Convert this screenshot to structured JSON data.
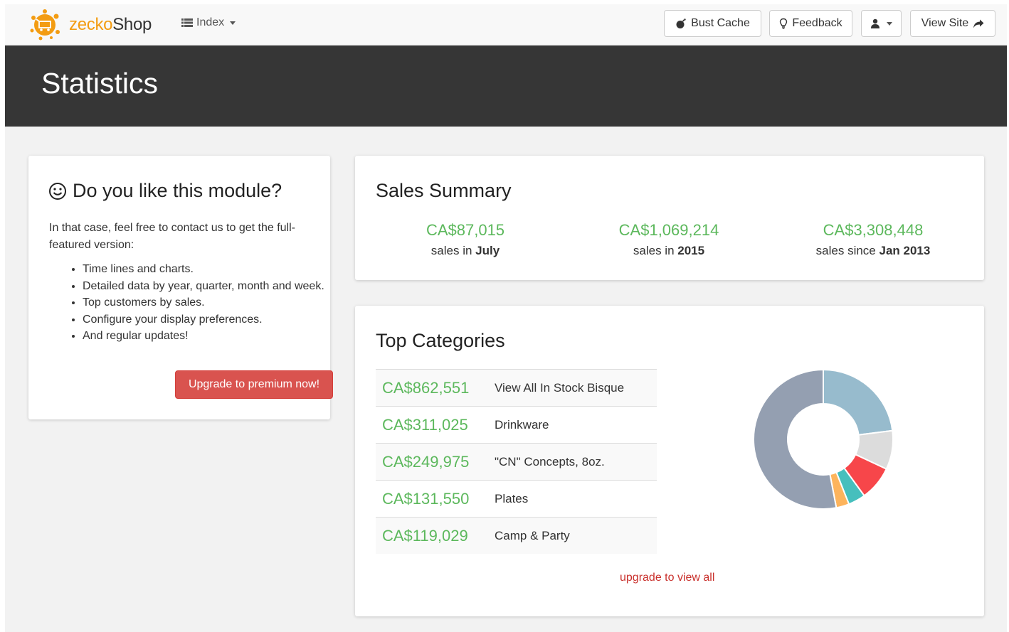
{
  "nav": {
    "brand_part1": "zecko",
    "brand_part2": "Shop",
    "index_label": "Index",
    "bust_cache_label": "Bust Cache",
    "feedback_label": "Feedback",
    "view_site_label": "View Site"
  },
  "header": {
    "title": "Statistics"
  },
  "promo": {
    "title": "Do you like this module?",
    "text": "In that case, feel free to contact us to get the full-featured version:",
    "features": [
      "Time lines and charts.",
      "Detailed data by year, quarter, month and week.",
      "Top customers by sales.",
      "Configure your display preferences.",
      "And regular updates!"
    ],
    "button_label": "Upgrade to premium now!"
  },
  "summary": {
    "title": "Sales Summary",
    "stats": [
      {
        "value": "CA$87,015",
        "prefix": "sales in ",
        "bold": "July"
      },
      {
        "value": "CA$1,069,214",
        "prefix": "sales in ",
        "bold": "2015"
      },
      {
        "value": "CA$3,308,448",
        "prefix": "sales since ",
        "bold": "Jan 2013"
      }
    ]
  },
  "categories": {
    "title": "Top Categories",
    "rows": [
      {
        "value": "CA$862,551",
        "name": "View All In Stock Bisque"
      },
      {
        "value": "CA$311,025",
        "name": "Drinkware"
      },
      {
        "value": "CA$249,975",
        "name": "\"CN\" Concepts, 8oz."
      },
      {
        "value": "CA$131,550",
        "name": "Plates"
      },
      {
        "value": "CA$119,029",
        "name": "Camp & Party"
      }
    ],
    "upgrade_link": "upgrade to view all",
    "donut": {
      "segments": [
        {
          "value": 0.23,
          "color": "#97bbcd"
        },
        {
          "value": 0.09,
          "color": "#dcdcdc"
        },
        {
          "value": 0.08,
          "color": "#f7464a"
        },
        {
          "value": 0.04,
          "color": "#46bfbd"
        },
        {
          "value": 0.03,
          "color": "#fdb45c"
        },
        {
          "value": 0.53,
          "color": "#949fb1"
        }
      ]
    }
  },
  "colors": {
    "accent_green": "#5cb85c",
    "danger_red": "#d9534f",
    "brand_orange": "#f39c12",
    "header_dark": "#363636"
  }
}
